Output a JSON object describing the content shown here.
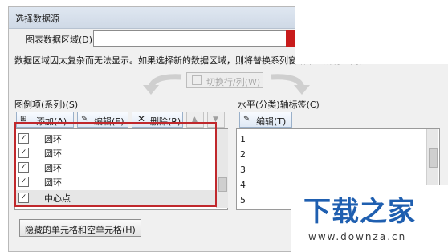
{
  "dialog": {
    "title": "选择数据源",
    "data_range_label": "图表数据区域(D):",
    "info_text": "数据区域因太复杂而无法显示。如果选择新的数据区域，则将替换系列窗格中的所有系列。",
    "switch_button_label": "切换行/列(W)",
    "legend_section_label": "图例项(系列)(S)",
    "axis_section_label": "水平(分类)轴标签(C)",
    "legend_toolbar": {
      "add_label": "添加(A)",
      "edit_label": "编辑(E)",
      "delete_label": "删除(R)"
    },
    "axis_toolbar": {
      "edit_label": "编辑(T)"
    },
    "series": [
      {
        "name": "圆环",
        "checked": true
      },
      {
        "name": "圆环",
        "checked": true
      },
      {
        "name": "圆环",
        "checked": true
      },
      {
        "name": "圆环",
        "checked": true
      },
      {
        "name": "中心点",
        "checked": true
      }
    ],
    "axis_labels": [
      "1",
      "2",
      "3",
      "4",
      "5"
    ],
    "hidden_cells_button_label": "隐藏的单元格和空单元格(H)"
  },
  "watermark": {
    "title": "下载之家",
    "url": "www.downza.cn"
  },
  "colors": {
    "highlight_red": "#c0282c",
    "watermark_blue": "#1f5fb0"
  }
}
